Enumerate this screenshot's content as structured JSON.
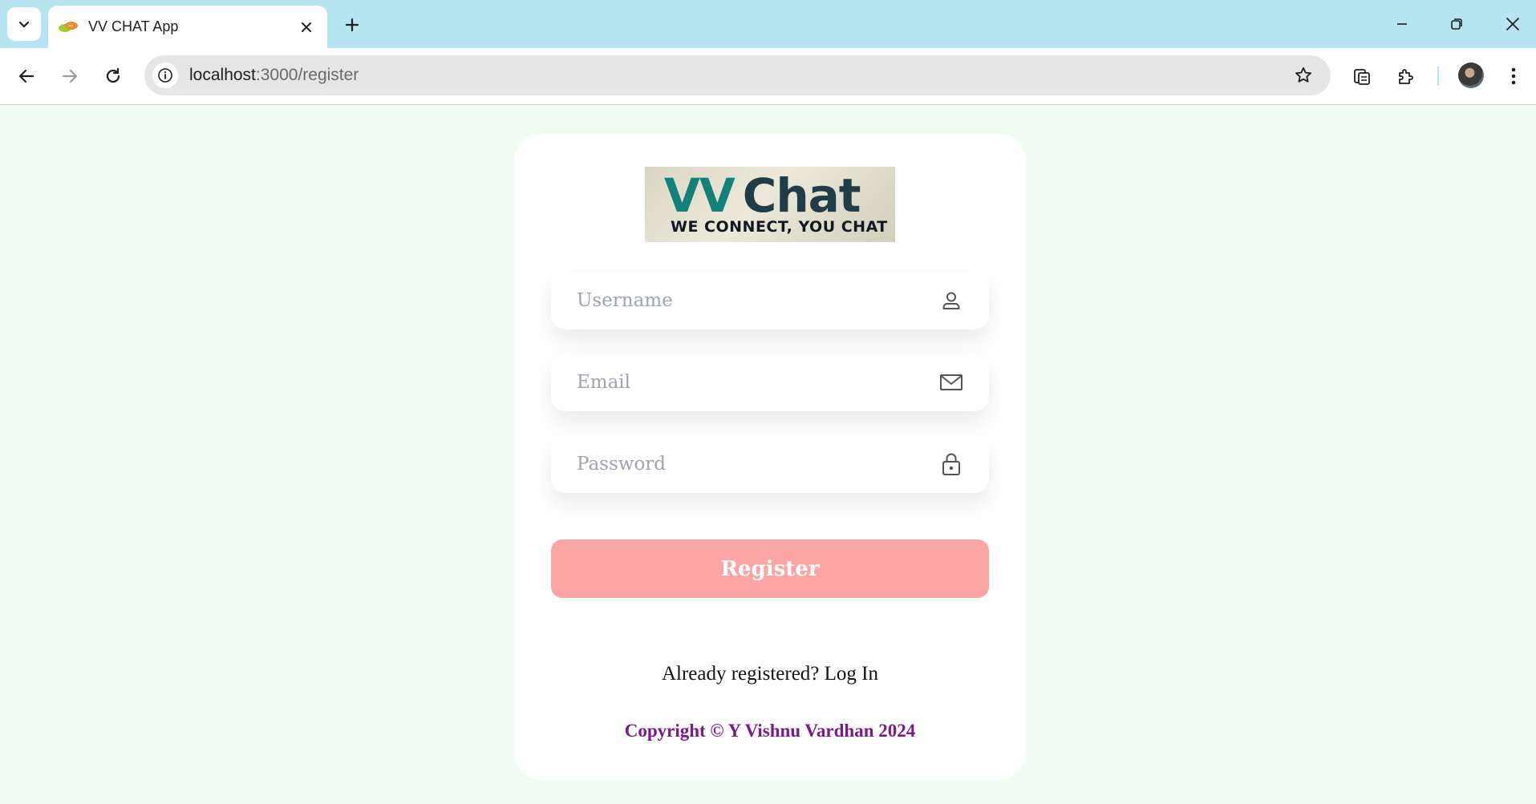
{
  "browser": {
    "tab_title": "VV CHAT App",
    "url_host": "localhost",
    "url_path": ":3000/register"
  },
  "logo": {
    "brand_vv": "VV",
    "brand_chat": "Chat",
    "tagline": "WE CONNECT, YOU CHAT"
  },
  "form": {
    "username_placeholder": "Username",
    "email_placeholder": "Email",
    "password_placeholder": "Password",
    "submit_label": "Register"
  },
  "footer": {
    "login_prompt": "Already registered?",
    "login_link": "Log In",
    "copyright": "Copyright © Y Vishnu Vardhan 2024"
  },
  "colors": {
    "page_background": "#f0fdf2",
    "tabbar_background": "#b6e4f1",
    "register_button": "#fca5a5",
    "copyright_text": "#7a1a8c"
  },
  "icons": [
    "chevron-down-icon",
    "favicon-icon",
    "close-icon",
    "plus-icon",
    "minimize-icon",
    "restore-icon",
    "back-icon",
    "forward-icon",
    "reload-icon",
    "site-info-icon",
    "star-icon",
    "tab-search-icon",
    "extensions-icon",
    "user-icon",
    "mail-icon",
    "lock-icon"
  ]
}
